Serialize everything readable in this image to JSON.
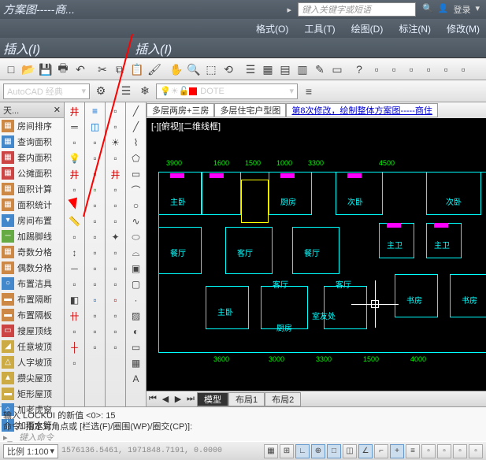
{
  "title": "方案图-----商...",
  "search": {
    "placeholder": "键入关键字或短语",
    "login": "登录"
  },
  "menus": [
    "格式(O)",
    "工具(T)",
    "绘图(D)",
    "标注(N)",
    "修改(M)"
  ],
  "insert_labels": [
    "插入(I)",
    "插入(I)"
  ],
  "workspace": "AutoCAD 经典",
  "layer": "DOTE",
  "left_panel": {
    "title": "天...",
    "close": "✕"
  },
  "left_items": [
    "房间排序",
    "查询面积",
    "套内面积",
    "公摊面积",
    "面积计算",
    "面积统计",
    "房间布置",
    "加踢脚线",
    "奇数分格",
    "偶数分格",
    "布置洁具",
    "布置隔断",
    "布置隔板",
    "搜屋顶线",
    "任意坡顶",
    "人字坡顶",
    "攒尖屋顶",
    "矩形屋顶",
    "加老虎窗",
    "加雨水管"
  ],
  "file_tabs": [
    "多层两房+三房",
    "多层住宅户型图"
  ],
  "file_link": "第8次修改，绘制整体方案图-----商住",
  "view_label": "[-][俯视][二维线框]",
  "rooms": [
    "主卧",
    "厨房",
    "次卧",
    "次卧",
    "餐厅",
    "客厅",
    "餐厅",
    "主卫",
    "主卫",
    "客厅",
    "客厅",
    "主卧",
    "书房",
    "书房",
    "书房",
    "厨房",
    "室友处"
  ],
  "dims": [
    "3900",
    "1600",
    "1500",
    "1000",
    "3300",
    "4500",
    "3600",
    "3000",
    "3300",
    "1500",
    "4000"
  ],
  "layout_tabs": [
    "模型",
    "布局1",
    "布局2"
  ],
  "cmd": {
    "line1": "输入 LOCKUI 的新值 <0>: 15",
    "line2": "命令: 指定对角点或 [栏选(F)/圈围(WP)/圈交(CP)]:",
    "prompt": "键入命令"
  },
  "status": {
    "scale": "比例 1:100",
    "coords": "1576136.5461, 1971848.7191, 0.0000"
  }
}
